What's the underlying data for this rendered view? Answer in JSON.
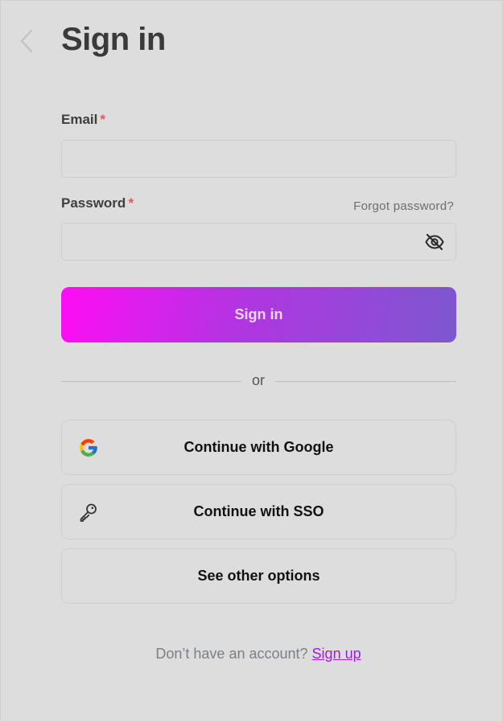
{
  "header": {
    "title": "Sign in"
  },
  "form": {
    "email": {
      "label": "Email",
      "required_mark": "*",
      "value": ""
    },
    "password": {
      "label": "Password",
      "required_mark": "*",
      "value": "",
      "forgot_link": "Forgot password?",
      "visibility_icon": "eye-off-icon"
    },
    "submit_label": "Sign in"
  },
  "divider": {
    "text": "or"
  },
  "alternatives": {
    "google_label": "Continue with Google",
    "google_icon": "google-icon",
    "sso_label": "Continue with SSO",
    "sso_icon": "key-icon",
    "other_label": "See other options"
  },
  "footer": {
    "prompt": "Don’t have an account?",
    "signup_link": "Sign up"
  },
  "colors": {
    "background": "#dedddd",
    "required": "#f0506e",
    "gradient_start": "#ff0cf5",
    "gradient_end": "#7c58d0",
    "link": "#9b1de8"
  }
}
